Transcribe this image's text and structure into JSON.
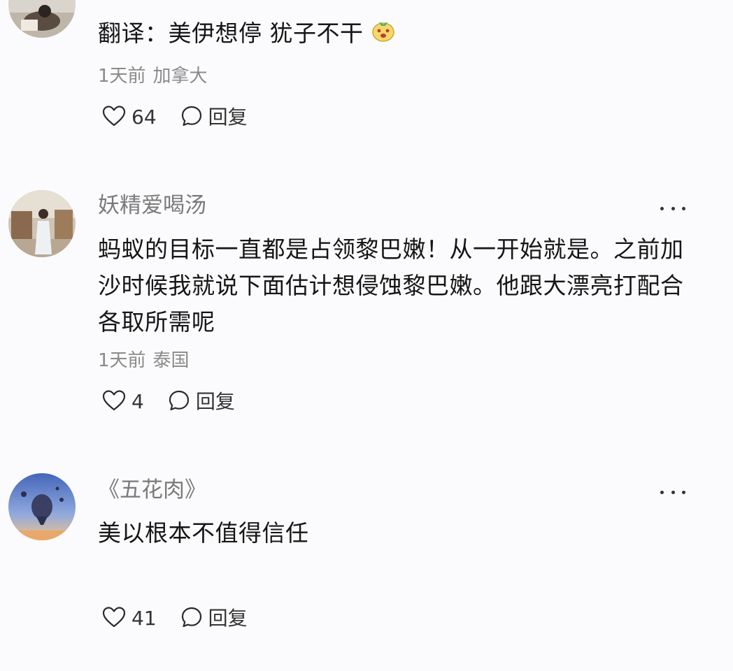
{
  "comments": [
    {
      "username": "",
      "text": "翻译：美伊想停 犹子不干",
      "emoji": "bear-face-emoji",
      "time": "1天前",
      "location": "加拿大",
      "likes": "64",
      "reply_label": "回复"
    },
    {
      "username": "妖精爱喝汤",
      "text": "蚂蚁的目标一直都是占领黎巴嫩！从一开始就是。之前加沙时候我就说下面估计想侵蚀黎巴嫩。他跟大漂亮打配合各取所需呢",
      "time": "1天前",
      "location": "泰国",
      "likes": "4",
      "reply_label": "回复"
    },
    {
      "username": "《五花肉》",
      "text": "美以根本不值得信任",
      "time": "",
      "location": "",
      "likes": "41",
      "reply_label": "回复"
    }
  ],
  "icons": {
    "like": "heart-outline-icon",
    "reply": "speech-bubble-icon",
    "more": "more-dots-icon"
  },
  "colors": {
    "background": "#fbfbfd",
    "username": "#7a7a7a",
    "meta": "#8a8a8a",
    "text": "#161616"
  }
}
